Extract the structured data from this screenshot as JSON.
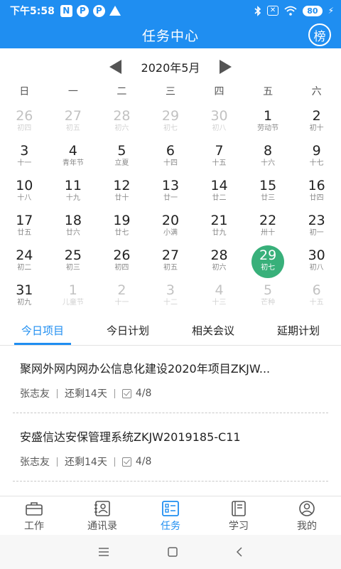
{
  "status_bar": {
    "time": "下午5:58",
    "n_badge": "N",
    "p_badge_1": "P",
    "p_badge_2": "P",
    "battery": "80",
    "x_badge": "✕"
  },
  "header": {
    "title": "任务中心",
    "rank_button": "榜"
  },
  "calendar": {
    "month_label": "2020年5月",
    "weekdays": [
      "日",
      "一",
      "二",
      "三",
      "四",
      "五",
      "六"
    ],
    "weeks": [
      [
        {
          "d": "26",
          "l": "初四",
          "other": true
        },
        {
          "d": "27",
          "l": "初五",
          "other": true
        },
        {
          "d": "28",
          "l": "初六",
          "other": true
        },
        {
          "d": "29",
          "l": "初七",
          "other": true
        },
        {
          "d": "30",
          "l": "初八",
          "other": true
        },
        {
          "d": "1",
          "l": "劳动节"
        },
        {
          "d": "2",
          "l": "初十"
        }
      ],
      [
        {
          "d": "3",
          "l": "十一"
        },
        {
          "d": "4",
          "l": "青年节"
        },
        {
          "d": "5",
          "l": "立夏"
        },
        {
          "d": "6",
          "l": "十四"
        },
        {
          "d": "7",
          "l": "十五"
        },
        {
          "d": "8",
          "l": "十六"
        },
        {
          "d": "9",
          "l": "十七"
        }
      ],
      [
        {
          "d": "10",
          "l": "十八"
        },
        {
          "d": "11",
          "l": "十九"
        },
        {
          "d": "12",
          "l": "廿十"
        },
        {
          "d": "13",
          "l": "廿一"
        },
        {
          "d": "14",
          "l": "廿二"
        },
        {
          "d": "15",
          "l": "廿三"
        },
        {
          "d": "16",
          "l": "廿四"
        }
      ],
      [
        {
          "d": "17",
          "l": "廿五"
        },
        {
          "d": "18",
          "l": "廿六"
        },
        {
          "d": "19",
          "l": "廿七"
        },
        {
          "d": "20",
          "l": "小满"
        },
        {
          "d": "21",
          "l": "廿九"
        },
        {
          "d": "22",
          "l": "卅十"
        },
        {
          "d": "23",
          "l": "初一"
        }
      ],
      [
        {
          "d": "24",
          "l": "初二"
        },
        {
          "d": "25",
          "l": "初三"
        },
        {
          "d": "26",
          "l": "初四"
        },
        {
          "d": "27",
          "l": "初五"
        },
        {
          "d": "28",
          "l": "初六"
        },
        {
          "d": "29",
          "l": "初七",
          "selected": true
        },
        {
          "d": "30",
          "l": "初八"
        }
      ],
      [
        {
          "d": "31",
          "l": "初九"
        },
        {
          "d": "1",
          "l": "儿童节",
          "other": true
        },
        {
          "d": "2",
          "l": "十一",
          "other": true
        },
        {
          "d": "3",
          "l": "十二",
          "other": true
        },
        {
          "d": "4",
          "l": "十三",
          "other": true
        },
        {
          "d": "5",
          "l": "芒种",
          "other": true
        },
        {
          "d": "6",
          "l": "十五",
          "other": true
        }
      ]
    ]
  },
  "tabs": [
    {
      "label": "今日项目",
      "active": true
    },
    {
      "label": "今日计划"
    },
    {
      "label": "相关会议"
    },
    {
      "label": "延期计划"
    }
  ],
  "tasks": [
    {
      "title": "聚网外网内网办公信息化建设2020年项目ZKJW...",
      "owner": "张志友",
      "remaining": "还剩14天",
      "progress": "4/8"
    },
    {
      "title": "安盛信达安保管理系统ZKJW2019185-C11",
      "owner": "张志友",
      "remaining": "还剩14天",
      "progress": "4/8"
    }
  ],
  "bottom_nav": [
    {
      "label": "工作",
      "icon": "briefcase-icon"
    },
    {
      "label": "通讯录",
      "icon": "contacts-icon"
    },
    {
      "label": "任务",
      "icon": "task-list-icon",
      "active": true
    },
    {
      "label": "学习",
      "icon": "book-icon"
    },
    {
      "label": "我的",
      "icon": "user-icon"
    }
  ],
  "colors": {
    "primary": "#1f8ef1",
    "selected_day": "#38b07a"
  }
}
